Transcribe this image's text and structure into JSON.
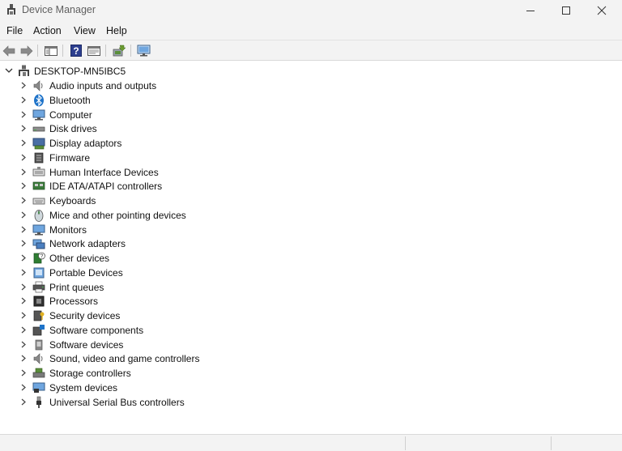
{
  "window": {
    "title": "Device Manager",
    "app_icon": "device-manager-icon"
  },
  "menubar": {
    "items": [
      {
        "label": "File"
      },
      {
        "label": "Action"
      },
      {
        "label": "View"
      },
      {
        "label": "Help"
      }
    ]
  },
  "toolbar": {
    "buttons": [
      "back-icon",
      "forward-icon",
      "show-hide-tree-icon",
      "help-icon",
      "properties-icon",
      "update-driver-icon",
      "scan-hardware-icon"
    ]
  },
  "tree": {
    "root": {
      "label": "DESKTOP-MN5IBC5",
      "icon": "computer-icon",
      "expanded": true
    },
    "categories": [
      {
        "label": "Audio inputs and outputs",
        "icon": "speaker-icon"
      },
      {
        "label": "Bluetooth",
        "icon": "bluetooth-icon"
      },
      {
        "label": "Computer",
        "icon": "monitor-icon"
      },
      {
        "label": "Disk drives",
        "icon": "disk-drive-icon"
      },
      {
        "label": "Display adaptors",
        "icon": "display-adapter-icon"
      },
      {
        "label": "Firmware",
        "icon": "firmware-icon"
      },
      {
        "label": "Human Interface Devices",
        "icon": "hid-icon"
      },
      {
        "label": "IDE ATA/ATAPI controllers",
        "icon": "ide-controller-icon"
      },
      {
        "label": "Keyboards",
        "icon": "keyboard-icon"
      },
      {
        "label": "Mice and other pointing devices",
        "icon": "mouse-icon"
      },
      {
        "label": "Monitors",
        "icon": "monitor-icon"
      },
      {
        "label": "Network adapters",
        "icon": "network-adapter-icon"
      },
      {
        "label": "Other devices",
        "icon": "unknown-device-icon"
      },
      {
        "label": "Portable Devices",
        "icon": "portable-device-icon"
      },
      {
        "label": "Print queues",
        "icon": "printer-icon"
      },
      {
        "label": "Processors",
        "icon": "processor-icon"
      },
      {
        "label": "Security devices",
        "icon": "security-device-icon"
      },
      {
        "label": "Software components",
        "icon": "software-component-icon"
      },
      {
        "label": "Software devices",
        "icon": "software-device-icon"
      },
      {
        "label": "Sound, video and game controllers",
        "icon": "speaker-icon"
      },
      {
        "label": "Storage controllers",
        "icon": "storage-controller-icon"
      },
      {
        "label": "System devices",
        "icon": "system-device-icon"
      },
      {
        "label": "Universal Serial Bus controllers",
        "icon": "usb-icon"
      }
    ]
  },
  "colors": {
    "chrome": "#f3f3f3",
    "tree_bg": "#ffffff",
    "text": "#111111",
    "title_text": "#5f5f5f",
    "accent_blue": "#1e73c9"
  }
}
